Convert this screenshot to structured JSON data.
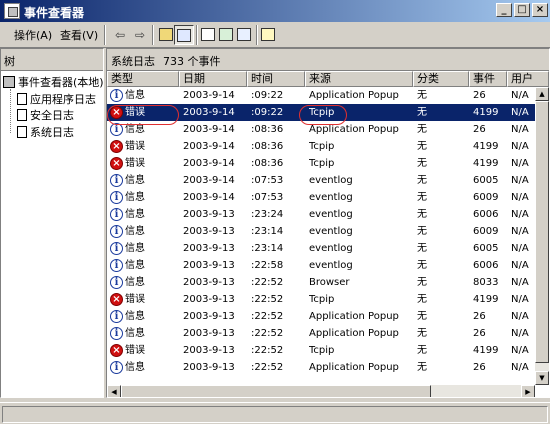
{
  "window": {
    "title": "事件查看器"
  },
  "menu": {
    "action": "操作(A)",
    "view": "查看(V)"
  },
  "toolbar": {
    "buttons": [
      "back-icon",
      "forward-icon",
      "up-folder-icon",
      "show-hide-tree-icon",
      "properties-icon",
      "refresh-icon",
      "export-list-icon",
      "help-icon"
    ]
  },
  "tree": {
    "tab_label": "树",
    "root": "事件查看器(本地)",
    "items": [
      "应用程序日志",
      "安全日志",
      "系统日志"
    ]
  },
  "pane": {
    "title": "系统日志",
    "count": "733 个事件"
  },
  "columns": [
    "类型",
    "日期",
    "时间",
    "来源",
    "分类",
    "事件",
    "用户"
  ],
  "rows": [
    {
      "type": "信息",
      "icon": "info",
      "date": "2003-9-14",
      "time": ":09:22",
      "source": "Application Popup",
      "category": "无",
      "event": "26",
      "user": "N/A"
    },
    {
      "type": "错误",
      "icon": "error",
      "date": "2003-9-14",
      "time": ":09:22",
      "source": "Tcpip",
      "category": "无",
      "event": "4199",
      "user": "N/A",
      "selected": true
    },
    {
      "type": "信息",
      "icon": "info",
      "date": "2003-9-14",
      "time": ":08:36",
      "source": "Application Popup",
      "category": "无",
      "event": "26",
      "user": "N/A"
    },
    {
      "type": "错误",
      "icon": "error",
      "date": "2003-9-14",
      "time": ":08:36",
      "source": "Tcpip",
      "category": "无",
      "event": "4199",
      "user": "N/A"
    },
    {
      "type": "错误",
      "icon": "error",
      "date": "2003-9-14",
      "time": ":08:36",
      "source": "Tcpip",
      "category": "无",
      "event": "4199",
      "user": "N/A"
    },
    {
      "type": "信息",
      "icon": "info",
      "date": "2003-9-14",
      "time": ":07:53",
      "source": "eventlog",
      "category": "无",
      "event": "6005",
      "user": "N/A"
    },
    {
      "type": "信息",
      "icon": "info",
      "date": "2003-9-14",
      "time": ":07:53",
      "source": "eventlog",
      "category": "无",
      "event": "6009",
      "user": "N/A"
    },
    {
      "type": "信息",
      "icon": "info",
      "date": "2003-9-13",
      "time": ":23:24",
      "source": "eventlog",
      "category": "无",
      "event": "6006",
      "user": "N/A"
    },
    {
      "type": "信息",
      "icon": "info",
      "date": "2003-9-13",
      "time": ":23:14",
      "source": "eventlog",
      "category": "无",
      "event": "6009",
      "user": "N/A"
    },
    {
      "type": "信息",
      "icon": "info",
      "date": "2003-9-13",
      "time": ":23:14",
      "source": "eventlog",
      "category": "无",
      "event": "6005",
      "user": "N/A"
    },
    {
      "type": "信息",
      "icon": "info",
      "date": "2003-9-13",
      "time": ":22:58",
      "source": "eventlog",
      "category": "无",
      "event": "6006",
      "user": "N/A"
    },
    {
      "type": "信息",
      "icon": "info",
      "date": "2003-9-13",
      "time": ":22:52",
      "source": "Browser",
      "category": "无",
      "event": "8033",
      "user": "N/A"
    },
    {
      "type": "错误",
      "icon": "error",
      "date": "2003-9-13",
      "time": ":22:52",
      "source": "Tcpip",
      "category": "无",
      "event": "4199",
      "user": "N/A"
    },
    {
      "type": "信息",
      "icon": "info",
      "date": "2003-9-13",
      "time": ":22:52",
      "source": "Application Popup",
      "category": "无",
      "event": "26",
      "user": "N/A"
    },
    {
      "type": "信息",
      "icon": "info",
      "date": "2003-9-13",
      "time": ":22:52",
      "source": "Application Popup",
      "category": "无",
      "event": "26",
      "user": "N/A"
    },
    {
      "type": "错误",
      "icon": "error",
      "date": "2003-9-13",
      "time": ":22:52",
      "source": "Tcpip",
      "category": "无",
      "event": "4199",
      "user": "N/A"
    },
    {
      "type": "信息",
      "icon": "info",
      "date": "2003-9-13",
      "time": ":22:52",
      "source": "Application Popup",
      "category": "无",
      "event": "26",
      "user": "N/A"
    }
  ],
  "colors": {
    "selection": "#0a246a",
    "annotation": "#e03030",
    "error": "#d01010",
    "info": "#1a3a9c"
  }
}
